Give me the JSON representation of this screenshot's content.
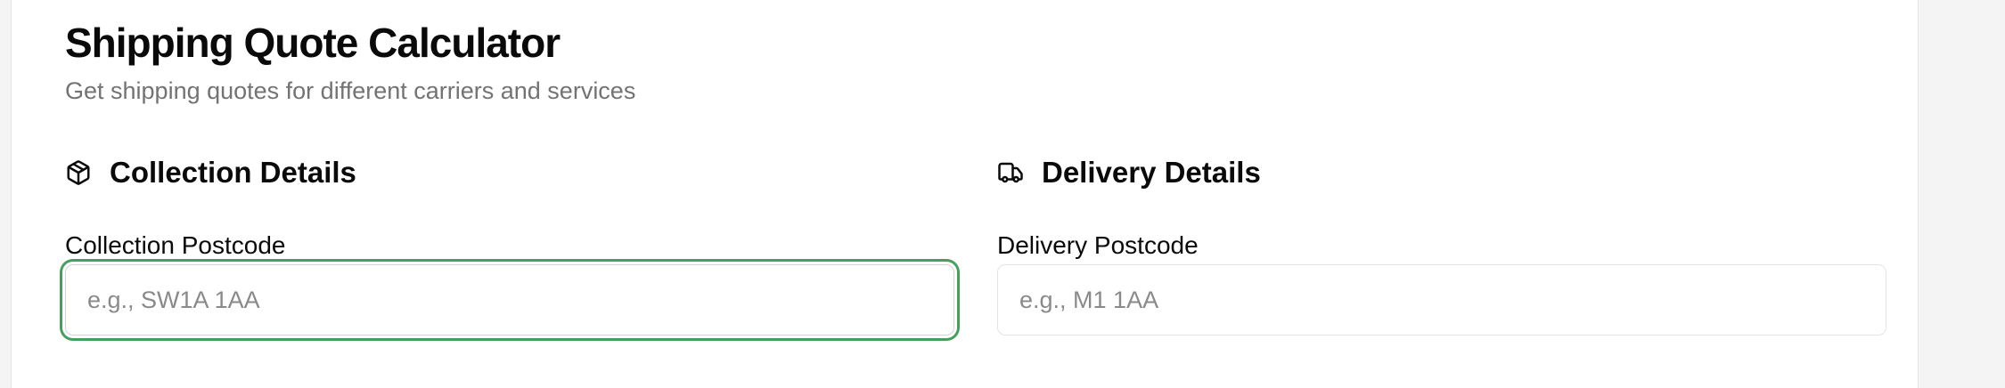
{
  "header": {
    "title": "Shipping Quote Calculator",
    "subtitle": "Get shipping quotes for different carriers and services"
  },
  "collection": {
    "heading": "Collection Details",
    "icon": "package-icon",
    "postcode_label": "Collection Postcode",
    "postcode_placeholder": "e.g., SW1A 1AA",
    "postcode_value": ""
  },
  "delivery": {
    "heading": "Delivery Details",
    "icon": "truck-icon",
    "postcode_label": "Delivery Postcode",
    "postcode_placeholder": "e.g., M1 1AA",
    "postcode_value": ""
  },
  "colors": {
    "focus_ring": "#46a05b",
    "muted_text": "#737373",
    "border": "#e4e4e7"
  }
}
